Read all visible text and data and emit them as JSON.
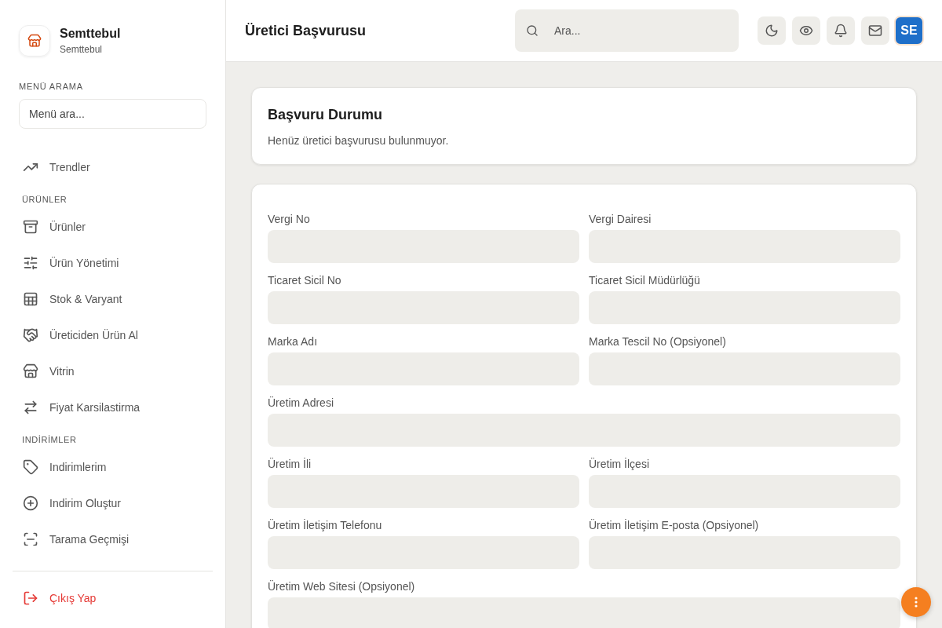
{
  "brand": {
    "name": "Semttebul",
    "subtitle": "Semttebul"
  },
  "menu_search": {
    "label": "MENÜ ARAMA",
    "placeholder": "Menü ara..."
  },
  "nav": [
    {
      "kind": "item",
      "label": "Trendler"
    },
    {
      "kind": "section",
      "label": "ÜRÜNLER"
    },
    {
      "kind": "item",
      "label": "Ürünler"
    },
    {
      "kind": "item",
      "label": "Ürün Yönetimi"
    },
    {
      "kind": "item",
      "label": "Stok & Varyant"
    },
    {
      "kind": "item",
      "label": "Üreticiden Ürün Al"
    },
    {
      "kind": "item",
      "label": "Vitrin"
    },
    {
      "kind": "item",
      "label": "Fiyat Karsilastirma"
    },
    {
      "kind": "section",
      "label": "INDİRİMLER"
    },
    {
      "kind": "item",
      "label": "Indirimlerim"
    },
    {
      "kind": "item",
      "label": "Indirim Oluştur"
    },
    {
      "kind": "item",
      "label": "Tarama Geçmişi"
    }
  ],
  "logout": "Çıkış Yap",
  "header": {
    "title": "Üretici Başvurusu",
    "search_placeholder": "Ara...",
    "avatar": "SE"
  },
  "status_card": {
    "title": "Başvuru Durumu",
    "text": "Henüz üretici başvurusu bulunmuyor."
  },
  "form": [
    {
      "kind": "half",
      "label": "Vergi No"
    },
    {
      "kind": "half",
      "label": "Vergi Dairesi"
    },
    {
      "kind": "half",
      "label": "Ticaret Sicil No"
    },
    {
      "kind": "half",
      "label": "Ticaret Sicil Müdürlüğü"
    },
    {
      "kind": "half",
      "label": "Marka Adı"
    },
    {
      "kind": "half",
      "label": "Marka Tescil No (Opsiyonel)"
    },
    {
      "kind": "full",
      "label": "Üretim Adresi"
    },
    {
      "kind": "half",
      "label": "Üretim İli"
    },
    {
      "kind": "half",
      "label": "Üretim İlçesi"
    },
    {
      "kind": "half",
      "label": "Üretim İletişim Telefonu"
    },
    {
      "kind": "half",
      "label": "Üretim İletişim E-posta (Opsiyonel)"
    },
    {
      "kind": "full",
      "label": "Üretim Web Sitesi (Opsiyonel)"
    }
  ]
}
